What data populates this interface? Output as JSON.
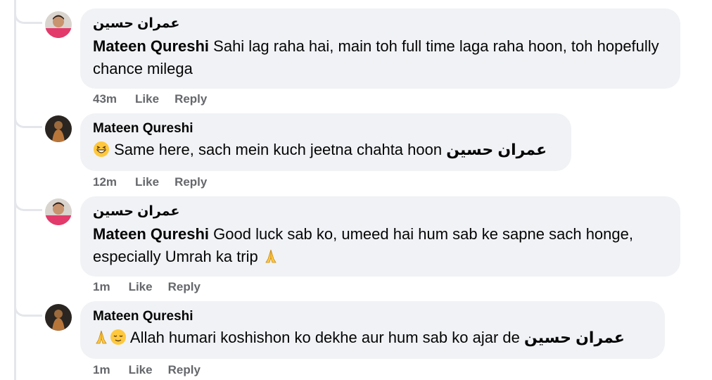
{
  "comments": [
    {
      "author": "عمران حسين",
      "mention": "Mateen Qureshi",
      "text": " Sahi lag raha hai, main toh full time laga raha hoon, toh hopefully chance milega",
      "time": "43m",
      "like_label": "Like",
      "reply_label": "Reply"
    },
    {
      "author": "Mateen Qureshi",
      "text": "Same here, sach mein kuch jeetna chahta hoon ",
      "mention": "عمران حسين",
      "emoji": "grinning-squint-emoji",
      "time": "12m",
      "like_label": "Like",
      "reply_label": "Reply"
    },
    {
      "author": "عمران حسين",
      "mention": "Mateen Qureshi",
      "text": " Good luck sab ko, umeed hai hum sab ke sapne sach honge, especially Umrah ka trip ",
      "emoji": "folded-hands-emoji",
      "time": "1m",
      "like_label": "Like",
      "reply_label": "Reply"
    },
    {
      "author": "Mateen Qureshi",
      "text": " Allah humari koshishon ko dekhe aur hum sab ko ajar de ",
      "mention": "عمران حسين",
      "emoji_1": "folded-hands-emoji",
      "emoji_2": "relieved-face-emoji",
      "time": "1m",
      "like_label": "Like",
      "reply_label": "Reply"
    }
  ],
  "colors": {
    "bubble": "#f0f2f5",
    "thread_line": "#e4e6eb",
    "meta_text": "#65676b"
  }
}
